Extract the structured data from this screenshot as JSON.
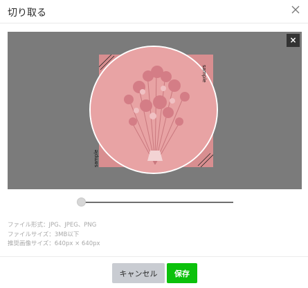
{
  "dialog": {
    "title": "切り取る",
    "close_icon": "close-icon"
  },
  "editor": {
    "stage_close_label": "×",
    "watermark_text": "sample",
    "zoom": 0
  },
  "info": {
    "lines": [
      "ファイル形式：JPG、JPEG、PNG",
      "ファイルサイズ：3MB以下",
      "推奨画像サイズ：640px × 640px"
    ]
  },
  "footer": {
    "cancel_label": "キャンセル",
    "save_label": "保存"
  },
  "colors": {
    "accent_green": "#0bc10b",
    "stage_gray": "#7b7b7b",
    "image_pink": "#e8a3a4"
  }
}
